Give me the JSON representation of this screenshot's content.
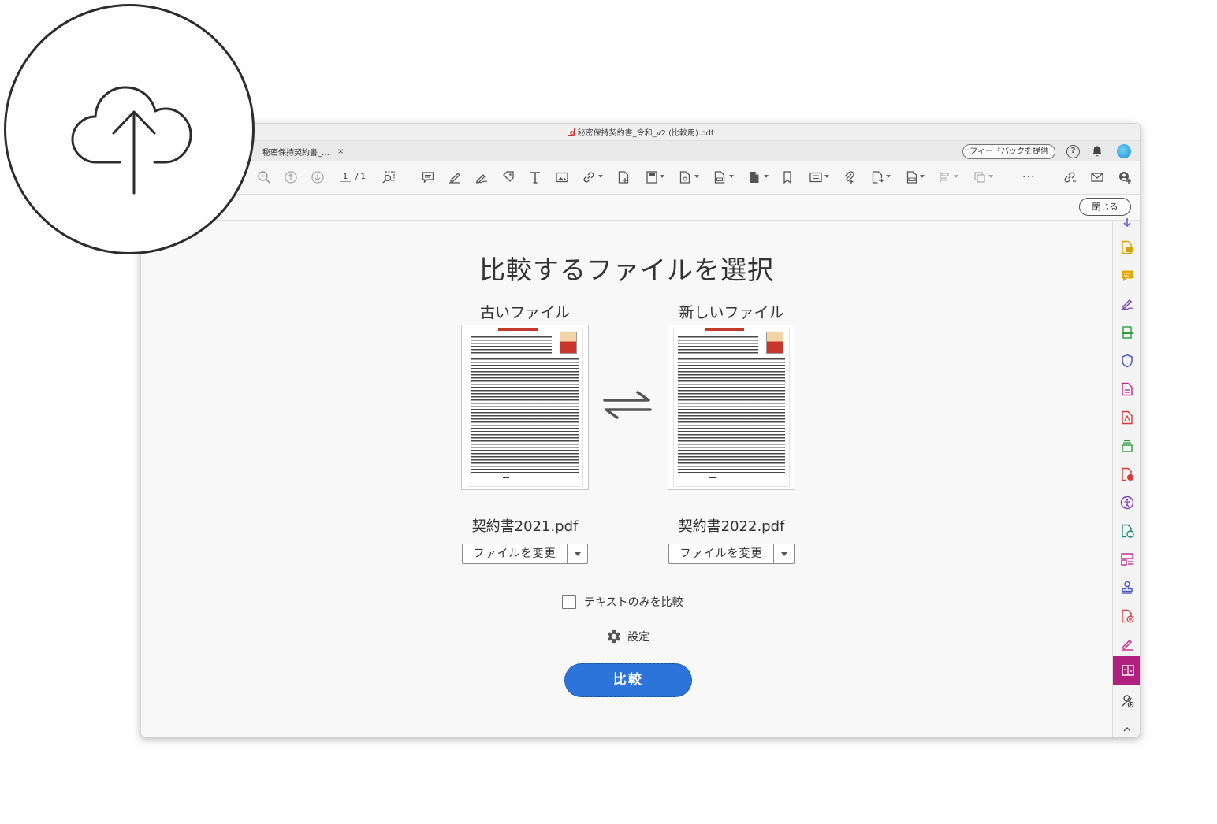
{
  "window": {
    "title": "秘密保持契約書_令和_v2 (比較用).pdf",
    "tab_label": "秘密保持契約書_…",
    "tab_close": "×",
    "feedback_label": "フィードバックを提供",
    "help_label": "?"
  },
  "toolbar": {
    "page_current": "1",
    "page_total": "/ 1",
    "more_label": "···"
  },
  "close_button": "閉じる",
  "compare": {
    "title": "比較するファイルを選択",
    "old_label": "古いファイル",
    "new_label": "新しいファイル",
    "old_filename": "契約書2021.pdf",
    "new_filename": "契約書2022.pdf",
    "change_file_label": "ファイルを変更",
    "text_only_label": "テキストのみを比較",
    "text_only_checked": false,
    "settings_label": "設定",
    "compare_button": "比較"
  },
  "icons": {
    "upload": "cloud-upload-icon",
    "rightbar": [
      "export-pdf-icon",
      "comment-icon",
      "fill-sign-icon",
      "scan-icon",
      "protect-icon",
      "create-pdf-icon",
      "edit-pdf-icon",
      "organize-icon",
      "redact-icon",
      "accessibility-icon",
      "compress-icon",
      "form-icon",
      "stamp-icon",
      "add-file-icon",
      "sign-icon",
      "compare-icon",
      "tools-icon",
      "collapse-icon"
    ]
  },
  "colors": {
    "accent_blue": "#2d74da",
    "active_tool": "#b2207e",
    "pdf_red": "#d2302f"
  }
}
